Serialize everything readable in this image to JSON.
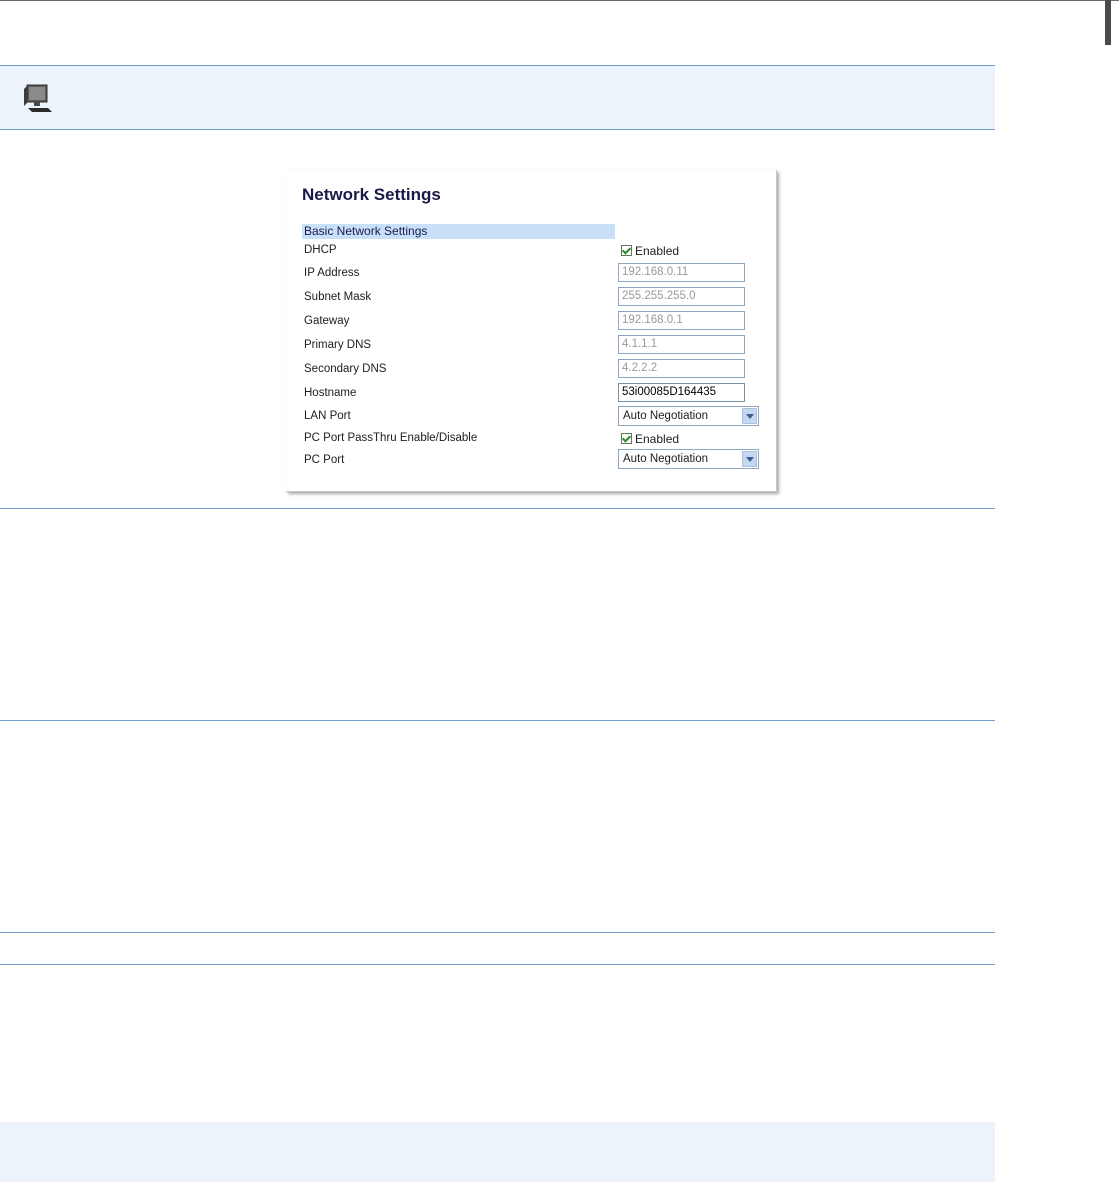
{
  "panel": {
    "title": "Network Settings",
    "section": "Basic Network Settings",
    "rows": {
      "dhcp": {
        "label": "DHCP",
        "checkbox_label": "Enabled",
        "checked": true
      },
      "ip": {
        "label": "IP Address",
        "value": "192.168.0.11"
      },
      "subnet": {
        "label": "Subnet Mask",
        "value": "255.255.255.0"
      },
      "gateway": {
        "label": "Gateway",
        "value": "192.168.0.1"
      },
      "pdns": {
        "label": "Primary DNS",
        "value": "4.1.1.1"
      },
      "sdns": {
        "label": "Secondary DNS",
        "value": "4.2.2.2"
      },
      "hostname": {
        "label": "Hostname",
        "value": "53i00085D164435"
      },
      "lan": {
        "label": "LAN Port",
        "value": "Auto Negotiation"
      },
      "passthru": {
        "label": "PC Port PassThru Enable/Disable",
        "checkbox_label": "Enabled",
        "checked": true
      },
      "pcport": {
        "label": "PC Port",
        "value": "Auto Negotiation"
      }
    }
  },
  "icons": {
    "header": "computer-icon"
  },
  "colors": {
    "band": "#edf3fa",
    "rule": "#6f9fd0",
    "section_head": "#c8e0f8",
    "title": "#1a1a4a"
  }
}
